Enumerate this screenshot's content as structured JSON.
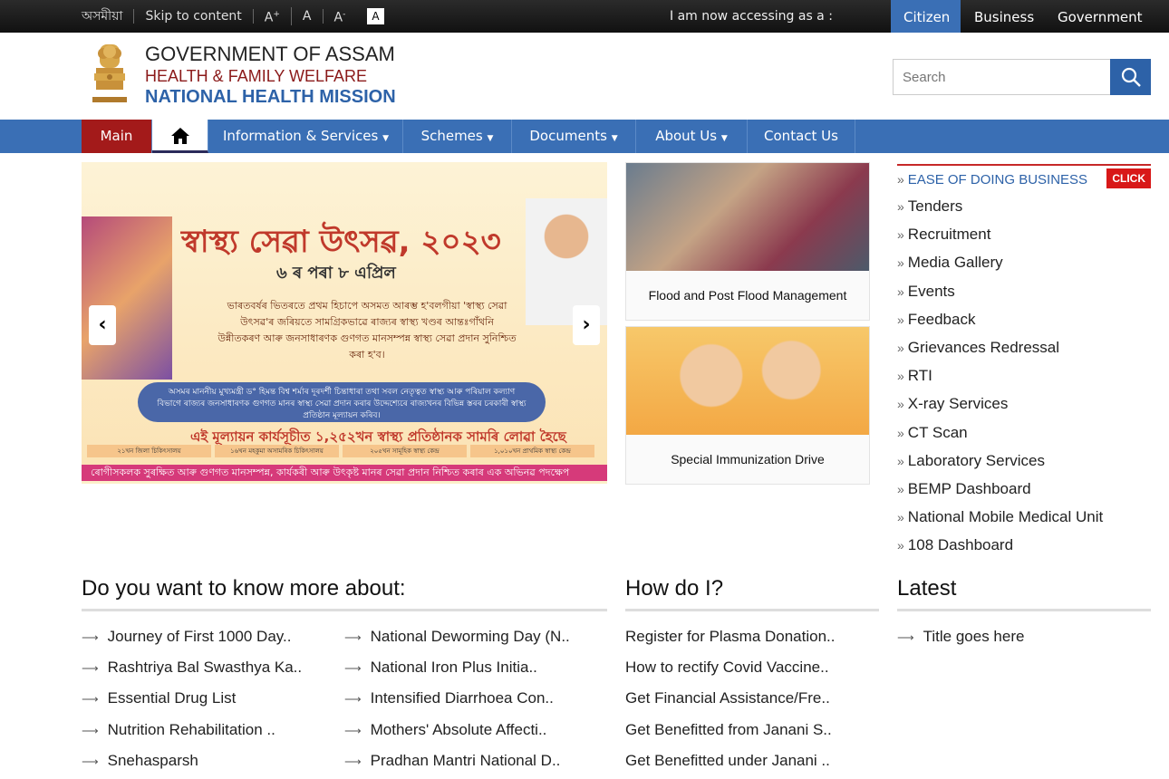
{
  "topbar": {
    "lang": "অসমীয়া",
    "skip": "Skip to content",
    "font_plus": "A+",
    "font_normal": "A",
    "font_minus": "A-",
    "font_contrast": "A",
    "accessing": "I am now accessing as a :",
    "roles": [
      "Citizen",
      "Business",
      "Government"
    ]
  },
  "header": {
    "gov": "GOVERNMENT OF ASSAM",
    "dept": "HEALTH & FAMILY WELFARE",
    "mission": "NATIONAL HEALTH MISSION",
    "search_placeholder": "Search"
  },
  "nav": {
    "main": "Main",
    "items": [
      "Information & Services",
      "Schemes",
      "Documents",
      "About Us",
      "Contact Us"
    ]
  },
  "slider": {
    "title": "স্বাস্থ্য সেৱা উৎসৱ, ২০২৩",
    "date": "৬ ৰ পৰা ৮ এপ্ৰিল",
    "text": "ভাৰতবৰ্ষৰ ভিতৰতে প্ৰথম হিচাপে অসমত আৰম্ভ হ'বলগীয়া 'স্বাস্থ্য সেৱা উৎসৱ'ৰ জৰিয়তে সামগ্ৰিকভাৱে ৰাজ্যৰ স্বাস্থ্য খণ্ডৰ আন্তঃগাঁথনি উন্নীতকৰণ আৰু জনসাধাৰণক গুণগত মানসম্পন্ন স্বাস্থ্য সেৱা প্ৰদান সুনিশ্চিত কৰা হ'ব।",
    "pill": "অসমৰ মাননীয় মুখ্যমন্ত্ৰী ড° হিমন্ত বিশ্ব শৰ্মাৰ দূৰদৰ্শী চিন্তাধাৰা তথা সবল নেতৃত্বত স্বাস্থ্য আৰু পৰিয়াল কল্যাণ বিভাগে ৰাজ্যৰ জনসাধাৰণক গুণগত মানৰ স্বাস্থ্য সেৱা প্ৰদান কৰাৰ উদ্দেশ্যেৰে ৰাজ্যখনৰ বিভিন্ন স্তৰৰ চৰকাৰী স্বাস্থ্য প্ৰতিষ্ঠান মূল্যায়ন কৰিব।",
    "red": "এই মূল্যায়ন কাৰ্যসূচীত ১,২৫২খন স্বাস্থ্য প্ৰতিষ্ঠানক সামৰি লোৱা হৈছে",
    "boxes": [
      "২১খন জিলা চিকিৎসালয়",
      "১৬খন মহকুমা অসামৰিক চিকিৎসালয়",
      "২০৫খন সামূহিক স্বাস্থ্য কেন্দ্ৰ",
      "১,০১০খন প্ৰাথমিক স্বাস্থ্য কেন্দ্ৰ"
    ],
    "bottom": "ৰোগীসকলক সুৰক্ষিত আৰু গুণগত মানসম্পন্ন, কাৰ্যকৰী আৰু উৎকৃষ্ট মানৰ সেৱা প্ৰদান নিশ্চিত কৰাৰ এক অভিনৱ পদক্ষেপ",
    "prev": "‹",
    "next": "›"
  },
  "cards": [
    {
      "caption": "Flood and Post Flood Management"
    },
    {
      "caption": "Special Immunization Drive"
    }
  ],
  "right": {
    "eodb": "EASE OF DOING BUSINESS",
    "click": "CLICK",
    "links": [
      "Tenders",
      "Recruitment",
      "Media Gallery",
      "Events",
      "Feedback",
      "Grievances Redressal",
      "RTI",
      "X-ray Services",
      "CT Scan",
      "Laboratory Services",
      "BEMP Dashboard",
      "National Mobile Medical Unit",
      "108 Dashboard"
    ]
  },
  "know": {
    "title": "Do you want to know more about:",
    "col1": [
      "Journey of First 1000 Day..",
      "Rashtriya Bal Swasthya Ka..",
      "Essential Drug List",
      "Nutrition Rehabilitation ..",
      "Snehasparsh"
    ],
    "col2": [
      "National Deworming Day (N..",
      "National Iron Plus Initia..",
      "Intensified Diarrhoea Con..",
      "Mothers' Absolute Affecti..",
      "Pradhan Mantri National D.."
    ]
  },
  "howdoi": {
    "title": "How do I?",
    "items": [
      "Register for Plasma Donation..",
      "How to rectify Covid Vaccine..",
      "Get Financial Assistance/Fre..",
      "Get Benefitted from Janani S..",
      "Get Benefitted under Janani .."
    ]
  },
  "latest": {
    "title": "Latest",
    "items": [
      "Title goes here"
    ]
  }
}
